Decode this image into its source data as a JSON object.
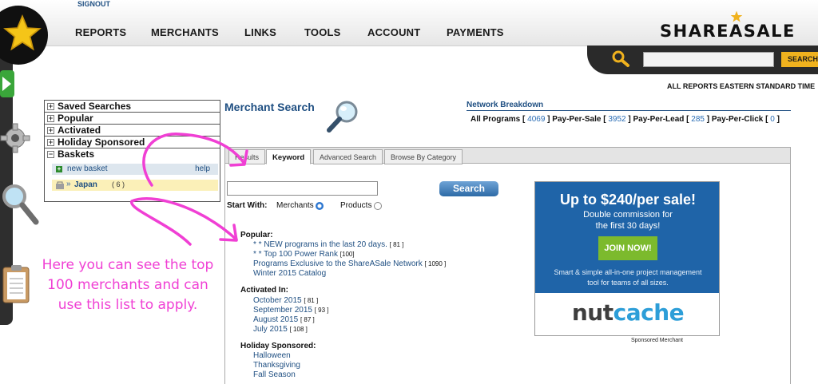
{
  "header": {
    "signout": "SIGNOUT",
    "nav": [
      "REPORTS",
      "MERCHANTS",
      "LINKS",
      "TOOLS",
      "ACCOUNT",
      "PAYMENTS"
    ],
    "logo": "SHAREASALE",
    "search_button": "SEARCH",
    "timezone_note": "ALL REPORTS EASTERN STANDARD TIME"
  },
  "dock": {
    "icons": [
      "star-icon",
      "play-arrow-icon",
      "gear-icon",
      "magnifier-icon",
      "clipboard-icon"
    ]
  },
  "sidebar": {
    "sections": [
      "Saved Searches",
      "Popular",
      "Activated",
      "Holiday Sponsored",
      "Baskets"
    ],
    "new_basket": "new basket",
    "help": "help",
    "basket_name": "Japan",
    "basket_count": "( 6 )"
  },
  "main": {
    "title": "Merchant Search",
    "network": {
      "title": "Network Breakdown",
      "all_label": "All Programs [",
      "all_val": "4069",
      "pps_label": "] Pay-Per-Sale [",
      "pps_val": "3952",
      "ppl_label": "] Pay-Per-Lead [",
      "ppl_val": "285",
      "ppc_label": "] Pay-Per-Click [",
      "ppc_val": "0",
      "close": "]"
    },
    "tabs": [
      "Results",
      "Keyword",
      "Advanced Search",
      "Browse By Category"
    ],
    "keyword_value": "",
    "search_button": "Search",
    "start_with": "Start With:",
    "radio_merchants": "Merchants",
    "radio_products": "Products",
    "selected_radio": "Merchants",
    "popular": {
      "heading": "Popular:",
      "items": [
        {
          "label": "* * NEW programs in the last 20 days.",
          "count": "[ 81 ]"
        },
        {
          "label": "* * Top 100 Power Rank",
          "count": "[100]"
        },
        {
          "label": "Programs Exclusive to the ShareASale Network",
          "count": "[ 1090 ]"
        },
        {
          "label": "Winter 2015 Catalog",
          "count": ""
        }
      ]
    },
    "activated": {
      "heading": "Activated In:",
      "items": [
        {
          "label": "October 2015",
          "count": "[ 81 ]"
        },
        {
          "label": "September 2015",
          "count": "[ 93 ]"
        },
        {
          "label": "August 2015",
          "count": "[ 87 ]"
        },
        {
          "label": "July 2015",
          "count": "[ 108 ]"
        }
      ]
    },
    "holiday": {
      "heading": "Holiday Sponsored:",
      "items": [
        "Halloween",
        "Thanksgiving",
        "Fall Season"
      ]
    }
  },
  "ad": {
    "headline": "Up to $240/per sale!",
    "line1": "Double commission for",
    "line2": "the first 30 days!",
    "cta": "JOIN NOW!",
    "small1": "Smart & simple all-in-one project management",
    "small2": "tool for teams of all sizes.",
    "logo_a": "nut",
    "logo_b": "cache",
    "caption": "Sponsored Merchant",
    "colors": {
      "background": "#1f64a8",
      "cta": "#7cba2d"
    }
  },
  "annotation": {
    "line1": "Here you can see the top",
    "line2": "100 merchants and can",
    "line3": "use this list to apply.",
    "color": "#f03fd4"
  }
}
